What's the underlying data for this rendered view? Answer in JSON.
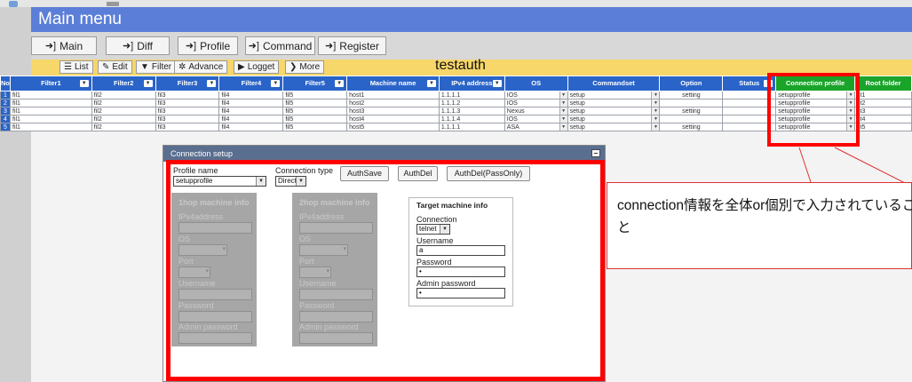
{
  "app": {
    "title": "Main menu",
    "table_name": "testauth"
  },
  "nav": [
    {
      "label": "Main",
      "icon": "login-arrow-icon"
    },
    {
      "label": "Diff",
      "icon": "login-arrow-icon"
    },
    {
      "label": "Profile",
      "icon": "login-arrow-icon"
    },
    {
      "label": "Command",
      "icon": "login-arrow-icon"
    },
    {
      "label": "Register",
      "icon": "login-arrow-icon"
    }
  ],
  "toolbar": [
    {
      "label": "List",
      "icon": "list-icon"
    },
    {
      "label": "Edit",
      "icon": "edit-icon"
    },
    {
      "label": "Filter",
      "icon": "filter-icon"
    },
    {
      "label": "Advance",
      "icon": "gear-icon"
    },
    {
      "label": "Logget",
      "icon": "play-icon"
    },
    {
      "label": "More",
      "icon": "chevron-right-icon"
    }
  ],
  "grid": {
    "headers": [
      "No",
      "Filter1",
      "Filter2",
      "Filter3",
      "Filter4",
      "Filter5",
      "Machine name",
      "IPv4 address",
      "OS",
      "Commandset",
      "Option",
      "Status",
      "Connection profile",
      "Root folder"
    ],
    "rows": [
      {
        "no": "1",
        "f1": "fil1",
        "f2": "fil2",
        "f3": "fil3",
        "f4": "fil4",
        "f5": "fil5",
        "name": "host1",
        "ip": "1.1.1.1",
        "os": "IOS",
        "cmd": "setup",
        "opt": "setting",
        "status": "",
        "profile": "setupprofile",
        "root": "st1"
      },
      {
        "no": "2",
        "f1": "fil1",
        "f2": "fil2",
        "f3": "fil3",
        "f4": "fil4",
        "f5": "fil5",
        "name": "host2",
        "ip": "1.1.1.2",
        "os": "IOS",
        "cmd": "setup",
        "opt": "",
        "status": "",
        "profile": "setupprofile",
        "root": "st2"
      },
      {
        "no": "3",
        "f1": "fil1",
        "f2": "fil2",
        "f3": "fil3",
        "f4": "fil4",
        "f5": "fil5",
        "name": "host3",
        "ip": "1.1.1.3",
        "os": "Nexus",
        "cmd": "setup",
        "opt": "setting",
        "status": "",
        "profile": "setupprofile",
        "root": "st3"
      },
      {
        "no": "4",
        "f1": "fil1",
        "f2": "fil2",
        "f3": "fil3",
        "f4": "fil4",
        "f5": "fil5",
        "name": "host4",
        "ip": "1.1.1.4",
        "os": "IOS",
        "cmd": "setup",
        "opt": "",
        "status": "",
        "profile": "setupprofile",
        "root": "st4"
      },
      {
        "no": "5",
        "f1": "fil1",
        "f2": "fil2",
        "f3": "fil3",
        "f4": "fil4",
        "f5": "fil5",
        "name": "host5",
        "ip": "1.1.1.1",
        "os": "ASA",
        "cmd": "setup",
        "opt": "setting",
        "status": "",
        "profile": "setupprofile",
        "root": "st5"
      }
    ]
  },
  "dialog": {
    "title": "Connection setup",
    "profile_name_label": "Profile name",
    "profile_name_value": "setupprofile",
    "connection_type_label": "Connection type",
    "connection_type_value": "Direct",
    "buttons": [
      "AuthSave",
      "AuthDel",
      "AuthDel(PassOnly)"
    ],
    "hop1": {
      "title": "1hop machine info",
      "fields": [
        "IPv4address",
        "OS",
        "Port",
        "Username",
        "Password",
        "Admin password"
      ]
    },
    "hop2": {
      "title": "2hop machine info",
      "fields": [
        "IPv4address",
        "OS",
        "Port",
        "Username",
        "Password",
        "Admin password"
      ]
    },
    "target": {
      "title": "Target machine info",
      "connection_label": "Connection",
      "connection_value": "telnet",
      "username_label": "Username",
      "username_value": "a",
      "password_label": "Password",
      "password_value": "•",
      "admin_password_label": "Admin password",
      "admin_password_value": "•"
    }
  },
  "callout": {
    "text": "connection情報を全体or個別で入力されていること"
  },
  "colors": {
    "menu_blue": "#5b7fd8",
    "header_blue": "#2a64c8",
    "header_green": "#1aa42a",
    "toolbar_yellow": "#f7d66a",
    "highlight_red": "#ff0000"
  }
}
